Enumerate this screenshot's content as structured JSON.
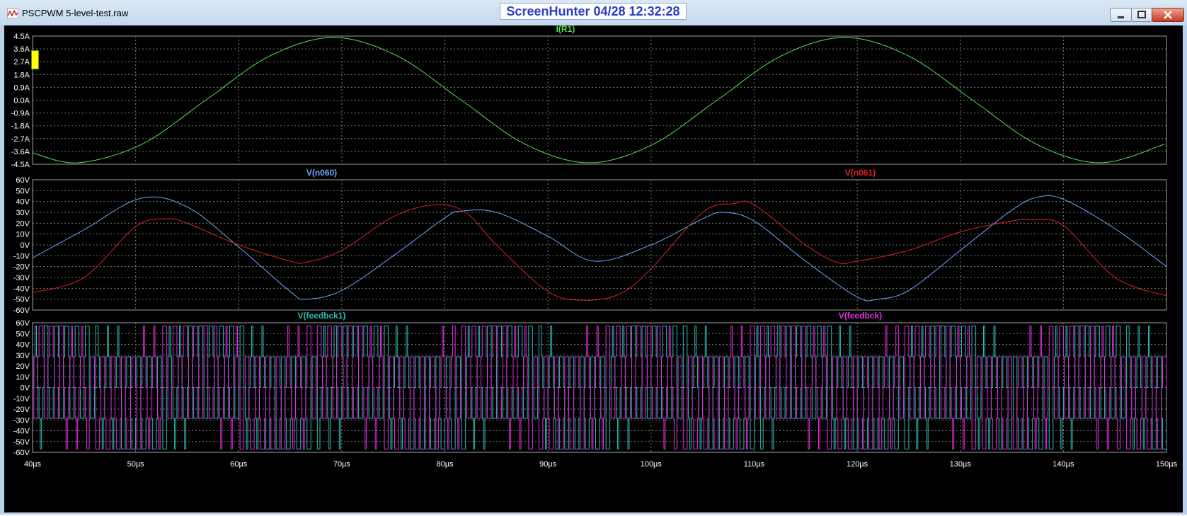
{
  "window": {
    "title": "PSCPWM 5-level-test.raw",
    "overlay_text": "ScreenHunter  04/28  12:32:28",
    "icons": [
      "waveform-app-icon",
      "minimize-icon",
      "maximize-icon",
      "close-icon"
    ]
  },
  "colors": {
    "background": "#000000",
    "grid": "#7a7a7a",
    "axis_text": "#ffffff",
    "I(R1)": "#55e055",
    "V(n060)": "#6ea8ff",
    "V(n061)": "#e02020",
    "V(feedbck1)": "#2fb9b2",
    "V(feedbck)": "#e030e0"
  },
  "chart_data": [
    {
      "type": "line",
      "x_range": [
        40,
        150
      ],
      "x_unit": "µs",
      "x_ticks": [
        "40µs",
        "50µs",
        "60µs",
        "70µs",
        "80µs",
        "90µs",
        "100µs",
        "110µs",
        "120µs",
        "130µs",
        "140µs",
        "150µs"
      ],
      "ylim": [
        -4.5,
        4.5
      ],
      "y_ticks": [
        "4.5A",
        "3.6A",
        "2.7A",
        "1.8A",
        "0.9A",
        "0.0A",
        "-0.9A",
        "-1.8A",
        "-2.7A",
        "-3.6A",
        "-4.5A"
      ],
      "grid": true,
      "series": [
        {
          "name": "I(R1)",
          "x": [
            40,
            44.4,
            50.6,
            56.8,
            63,
            69.2,
            75.4,
            81.6,
            87.8,
            94,
            100.2,
            106.4,
            112.6,
            118.8,
            125,
            131.2,
            137.4,
            143.6,
            149.8
          ],
          "y": [
            -3.7,
            -4.4,
            -3.1,
            0.0,
            3.1,
            4.4,
            3.1,
            0.0,
            -3.1,
            -4.4,
            -3.1,
            0.0,
            3.1,
            4.4,
            3.1,
            0.0,
            -3.1,
            -4.4,
            -3.1
          ]
        }
      ]
    },
    {
      "type": "line",
      "x_range": [
        40,
        150
      ],
      "x_unit": "µs",
      "ylim": [
        -60,
        60
      ],
      "y_ticks": [
        "60V",
        "50V",
        "40V",
        "30V",
        "20V",
        "10V",
        "0V",
        "-10V",
        "-20V",
        "-30V",
        "-40V",
        "-50V",
        "-60V"
      ],
      "grid": true,
      "series": [
        {
          "name": "V(n060)",
          "x": [
            40,
            45,
            50.5,
            55,
            60,
            65,
            66.5,
            70,
            75,
            80,
            81.5,
            85,
            90,
            94.5,
            100,
            105,
            107,
            110,
            115,
            120,
            122,
            125,
            130,
            135,
            137.5,
            140,
            145,
            150
          ],
          "y": [
            -12,
            14,
            43,
            35,
            -2,
            -43,
            -50,
            -42,
            -10,
            25,
            31,
            30,
            8,
            -15,
            0,
            24,
            30,
            22,
            -15,
            -48,
            -50,
            -42,
            -5,
            32,
            44,
            42,
            15,
            -20
          ]
        },
        {
          "name": "V(n061)",
          "x": [
            40,
            45,
            50,
            53,
            55,
            60,
            65,
            66.5,
            70,
            75,
            79,
            82,
            85,
            90,
            93.5,
            97,
            100,
            105,
            108,
            110,
            115,
            118,
            120,
            125,
            130,
            135,
            137,
            140,
            145,
            150
          ],
          "y": [
            -44,
            -30,
            17,
            24,
            20,
            0,
            -15,
            -16,
            -5,
            26,
            37,
            30,
            0,
            -43,
            -51,
            -45,
            -22,
            30,
            38,
            37,
            0,
            -16,
            -15,
            -5,
            12,
            22,
            23,
            18,
            -30,
            -47
          ]
        }
      ]
    },
    {
      "type": "line",
      "x_range": [
        40,
        150
      ],
      "x_unit": "µs",
      "ylim": [
        -60,
        60
      ],
      "y_ticks": [
        "60V",
        "50V",
        "40V",
        "30V",
        "20V",
        "10V",
        "0V",
        "-10V",
        "-20V",
        "-30V",
        "-40V",
        "-50V",
        "-60V"
      ],
      "grid": true,
      "series": [
        {
          "name": "V(feedbck1)",
          "pattern": "5-level stepped PWM",
          "amplitude": 57,
          "period": 1.0,
          "phase": 0.0
        },
        {
          "name": "V(feedbck)",
          "pattern": "5-level stepped PWM",
          "amplitude": 57,
          "period": 1.0,
          "phase": 0.5
        }
      ]
    }
  ]
}
